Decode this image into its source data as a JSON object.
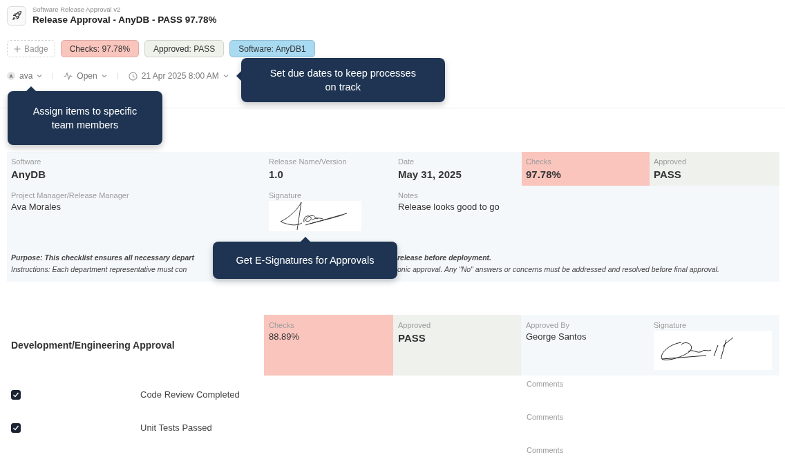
{
  "header": {
    "subtitle": "Software Release Approval v2",
    "title": "Release Approval - AnyDB - PASS 97.78%"
  },
  "badges": [
    {
      "kind": "add",
      "label": "Badge"
    },
    {
      "kind": "tag",
      "label": "Checks: 97.78%",
      "color": "#f9c5bd"
    },
    {
      "kind": "tag",
      "label": "Approved: PASS",
      "color": "#eef2ea"
    },
    {
      "kind": "tag",
      "label": "Software: AnyDB1",
      "color": "#a8daf1"
    }
  ],
  "meta": [
    {
      "kind": "assignee",
      "avatar": "A",
      "label": "ava",
      "tooltip": "Assign items to specific team members"
    },
    {
      "kind": "status",
      "label": "Open"
    },
    {
      "kind": "due",
      "label": "21 Apr 2025 8:00 AM",
      "tooltip": "Set due dates to keep processes on track"
    }
  ],
  "summary": {
    "rows": [
      [
        {
          "kind": "headline",
          "label": "Software",
          "value": "AnyDB"
        },
        {
          "kind": "headline",
          "label": "Release Name/Version",
          "value": "1.0"
        },
        {
          "kind": "headline",
          "label": "Date",
          "value": "May 31, 2025"
        },
        {
          "kind": "headline",
          "label": "Checks",
          "value": "97.78%",
          "color": "#f9c5bd"
        },
        {
          "kind": "headline",
          "label": "Approved",
          "value": "PASS",
          "color": "#eef1ec"
        }
      ],
      [
        {
          "kind": "text",
          "label": "Project Manager/Release Manager",
          "value": "Ava Morales"
        },
        {
          "kind": "signature",
          "label": "Signature"
        },
        {
          "kind": "text",
          "label": "Notes",
          "value": "Release looks good to go"
        }
      ]
    ],
    "purpose": {
      "left": "Purpose: This checklist ensures all necessary depart",
      "right": "release before deployment."
    },
    "instructions": {
      "left": "Instructions: Each department representative must con",
      "right": "onic approval. Any \"No\" answers or concerns must be addressed and resolved before final approval."
    },
    "tooltip": "Get E-Signatures for Approvals"
  },
  "sections": [
    {
      "title": "Development/Engineering Approval",
      "fields": [
        {
          "kind": "text",
          "label": "Checks",
          "value": "88.89%",
          "color": "#f9c5bd"
        },
        {
          "kind": "headline",
          "label": "Approved",
          "value": "PASS",
          "color": "#eef1ec"
        },
        {
          "kind": "text",
          "label": "Approved By",
          "value": "George Santos",
          "color": "#f4f8fb"
        },
        {
          "kind": "signature",
          "label": "Signature",
          "color": "#f4f8fb"
        }
      ],
      "items": [
        {
          "checked": true,
          "label": "Code Review Completed",
          "comments_label": "Comments"
        },
        {
          "checked": true,
          "label": "Unit Tests Passed",
          "comments_label": "Comments"
        },
        {
          "comments_label": "Comments"
        }
      ]
    }
  ]
}
